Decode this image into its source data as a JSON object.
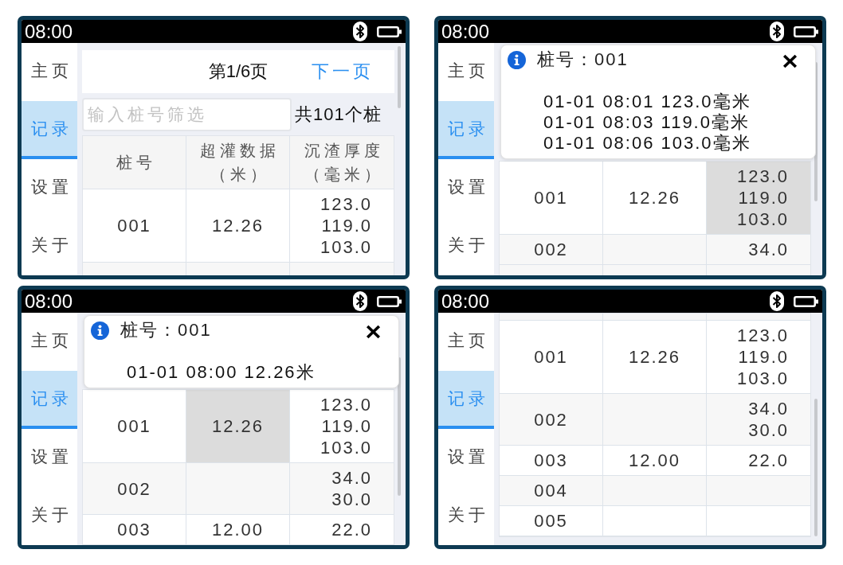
{
  "screens": [
    {
      "status_bar": {
        "time": "08:00"
      },
      "sidebar": [
        {
          "label": "主页",
          "selected": false
        },
        {
          "label": "记录",
          "selected": true
        },
        {
          "label": "设置",
          "selected": false
        },
        {
          "label": "关于",
          "selected": false
        }
      ],
      "pager": {
        "page": "第1/6页",
        "next": "下一页"
      },
      "filter": {
        "placeholder": "输入桩号筛选"
      },
      "total": "共101个桩",
      "table": {
        "columns": [
          {
            "title": "桩号"
          },
          {
            "title": "超灌数据",
            "unit": "（米）"
          },
          {
            "title": "沉渣厚度",
            "unit": "（毫米）"
          }
        ],
        "rows": [
          {
            "cells": [
              {
                "lines": [
                  "001"
                ],
                "selected": false
              },
              {
                "lines": [
                  "12.26"
                ],
                "selected": false
              },
              {
                "lines": [
                  "123.0",
                  "119.0",
                  "103.0"
                ],
                "selected": false
              }
            ]
          }
        ]
      }
    },
    {
      "status_bar": {
        "time": "08:00"
      },
      "sidebar": [
        {
          "label": "主页",
          "selected": false
        },
        {
          "label": "记录",
          "selected": true
        },
        {
          "label": "设置",
          "selected": false
        },
        {
          "label": "关于",
          "selected": false
        }
      ],
      "dialog": {
        "title": "桩号：001",
        "lines": [
          "01-01 08:01 123.0毫米",
          "01-01 08:03 119.0毫米",
          "01-01 08:06 103.0毫米"
        ]
      },
      "table": {
        "rows": [
          {
            "cells": [
              {
                "lines": [
                  "001"
                ],
                "selected": false
              },
              {
                "lines": [
                  "12.26"
                ],
                "selected": false
              },
              {
                "lines": [
                  "123.0",
                  "119.0",
                  "103.0"
                ],
                "selected": true
              }
            ]
          },
          {
            "cells": [
              {
                "lines": [
                  "002"
                ],
                "selected": false
              },
              {
                "selected": false
              },
              {
                "lines": [
                  "34.0"
                ],
                "selected": false
              }
            ]
          }
        ]
      }
    },
    {
      "status_bar": {
        "time": "08:00"
      },
      "sidebar": [
        {
          "label": "主页",
          "selected": false
        },
        {
          "label": "记录",
          "selected": true
        },
        {
          "label": "设置",
          "selected": false
        },
        {
          "label": "关于",
          "selected": false
        }
      ],
      "dialog": {
        "title": "桩号：001",
        "lines": [
          "01-01 08:00 12.26米"
        ]
      },
      "table": {
        "rows": [
          {
            "cells": [
              {
                "lines": [
                  "001"
                ],
                "selected": false
              },
              {
                "lines": [
                  "12.26"
                ],
                "selected": true
              },
              {
                "lines": [
                  "123.0",
                  "119.0",
                  "103.0"
                ],
                "selected": false
              }
            ]
          },
          {
            "cells": [
              {
                "lines": [
                  "002"
                ],
                "selected": false
              },
              {
                "selected": false
              },
              {
                "lines": [
                  "34.0",
                  "30.0"
                ],
                "selected": false
              }
            ]
          },
          {
            "cells": [
              {
                "lines": [
                  "003"
                ],
                "selected": false
              },
              {
                "lines": [
                  "12.00"
                ],
                "selected": false
              },
              {
                "lines": [
                  "22.0"
                ],
                "selected": false
              }
            ]
          }
        ]
      }
    },
    {
      "status_bar": {
        "time": "08:00"
      },
      "sidebar": [
        {
          "label": "主页",
          "selected": false
        },
        {
          "label": "记录",
          "selected": true
        },
        {
          "label": "设置",
          "selected": false
        },
        {
          "label": "关于",
          "selected": false
        }
      ],
      "table": {
        "rows": [
          {
            "cells": [
              {
                "lines": [
                  "001"
                ],
                "selected": false
              },
              {
                "lines": [
                  "12.26"
                ],
                "selected": false
              },
              {
                "lines": [
                  "123.0",
                  "119.0",
                  "103.0"
                ],
                "selected": false
              }
            ]
          },
          {
            "cells": [
              {
                "lines": [
                  "002"
                ],
                "selected": false
              },
              {
                "selected": false
              },
              {
                "lines": [
                  "34.0",
                  "30.0"
                ],
                "selected": false
              }
            ]
          },
          {
            "cells": [
              {
                "lines": [
                  "003"
                ],
                "selected": false
              },
              {
                "lines": [
                  "12.00"
                ],
                "selected": false
              },
              {
                "lines": [
                  "22.0"
                ],
                "selected": false
              }
            ]
          },
          {
            "cells": [
              {
                "lines": [
                  "004"
                ],
                "selected": false
              },
              {
                "selected": false
              },
              {
                "selected": false
              }
            ]
          },
          {
            "cells": [
              {
                "lines": [
                  "005"
                ],
                "selected": false
              },
              {
                "selected": false
              },
              {
                "selected": false
              }
            ]
          }
        ]
      }
    }
  ]
}
